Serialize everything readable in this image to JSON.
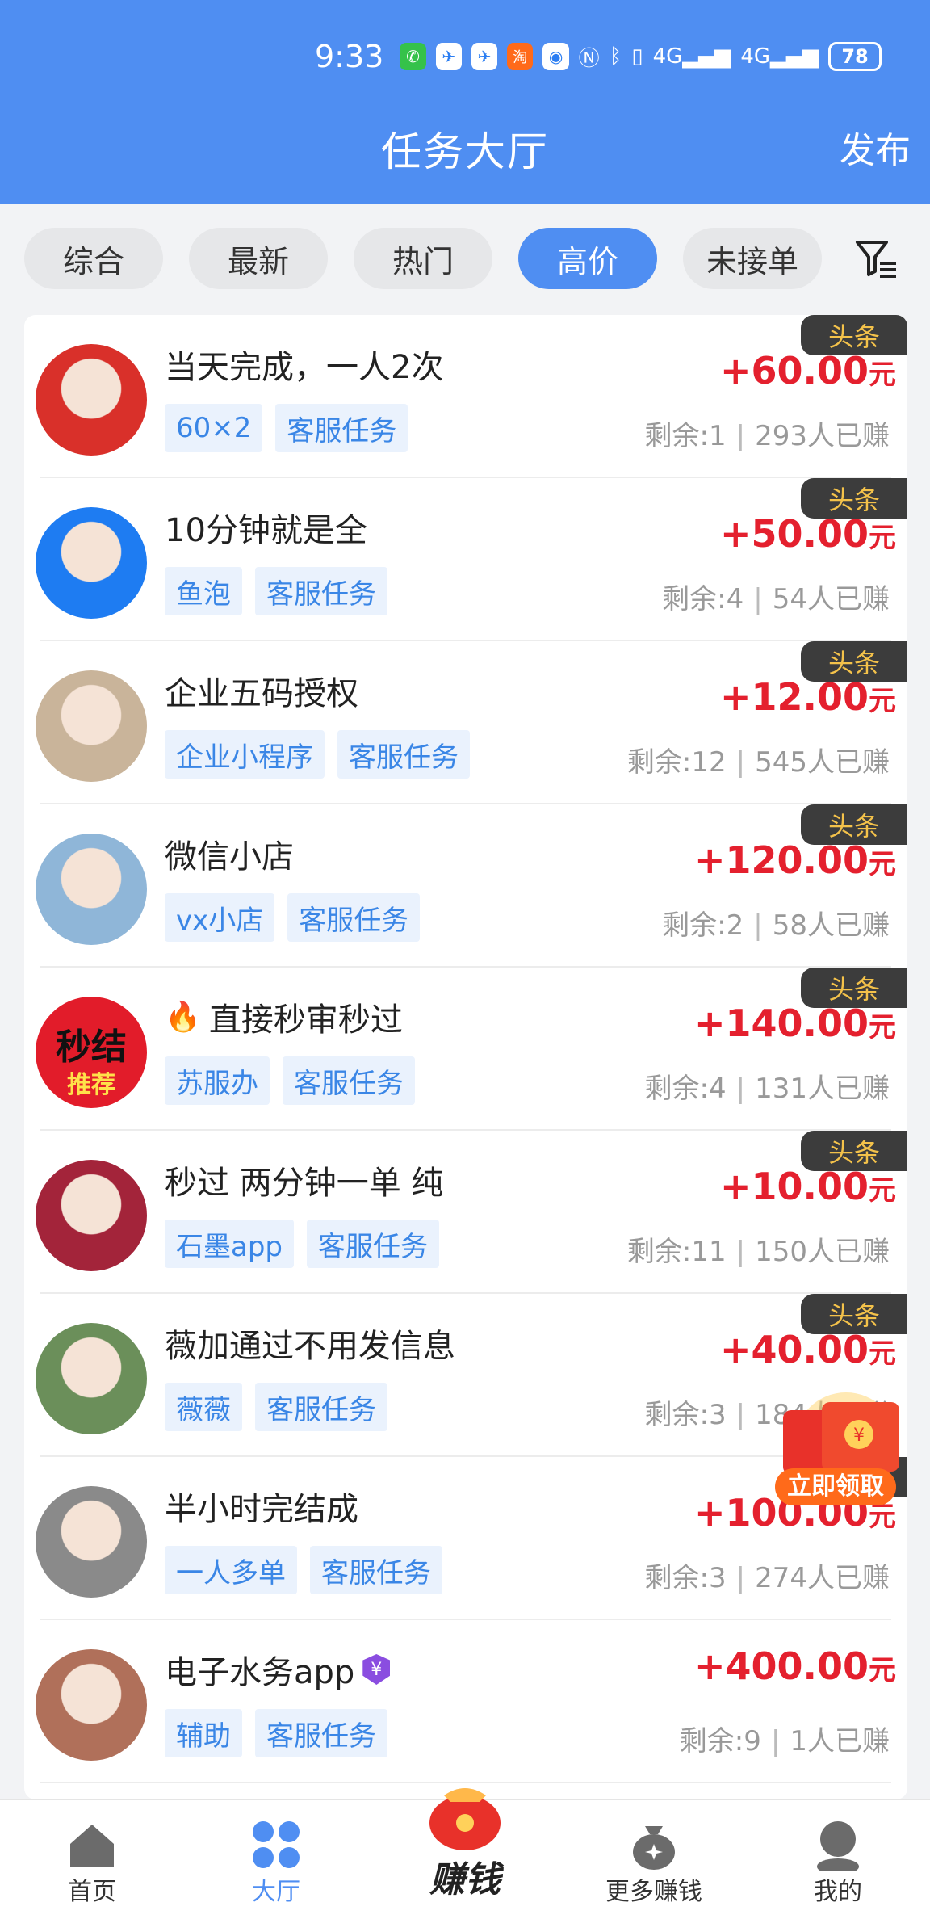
{
  "status_bar": {
    "time": "9:33",
    "network_1": "4G",
    "network_2": "4G",
    "battery": "78"
  },
  "header": {
    "title": "任务大厅",
    "publish_label": "发布"
  },
  "filters": [
    {
      "label": "综合",
      "active": false
    },
    {
      "label": "最新",
      "active": false
    },
    {
      "label": "热门",
      "active": false
    },
    {
      "label": "高价",
      "active": true
    },
    {
      "label": "未接单",
      "active": false
    }
  ],
  "tasks": [
    {
      "title": "当天完成，一人2次",
      "fire": false,
      "verified": false,
      "tags": [
        "60×2",
        "客服任务"
      ],
      "badge": "头条",
      "price": "+60.00",
      "unit": "元",
      "remaining": "剩余:1",
      "earned": "293人已赚",
      "avatar_color": "#d9302a"
    },
    {
      "title": "10分钟就是全",
      "fire": false,
      "verified": false,
      "tags": [
        "鱼泡",
        "客服任务"
      ],
      "badge": "头条",
      "price": "+50.00",
      "unit": "元",
      "remaining": "剩余:4",
      "earned": "54人已赚",
      "avatar_color": "#1e7cf2"
    },
    {
      "title": "企业五码授权",
      "fire": false,
      "verified": false,
      "tags": [
        "企业小程序",
        "客服任务"
      ],
      "badge": "头条",
      "price": "+12.00",
      "unit": "元",
      "remaining": "剩余:12",
      "earned": "545人已赚",
      "avatar_color": "#c9b49a"
    },
    {
      "title": "微信小店",
      "fire": false,
      "verified": false,
      "tags": [
        "vx小店",
        "客服任务"
      ],
      "badge": "头条",
      "price": "+120.00",
      "unit": "元",
      "remaining": "剩余:2",
      "earned": "58人已赚",
      "avatar_color": "#8fb6d8"
    },
    {
      "title": "直接秒审秒过",
      "fire": true,
      "verified": false,
      "tags": [
        "苏服办",
        "客服任务"
      ],
      "badge": "头条",
      "price": "+140.00",
      "unit": "元",
      "remaining": "剩余:4",
      "earned": "131人已赚",
      "avatar_color": "#e21c2a",
      "avatar_text_1": "秒结",
      "avatar_text_2": "推荐"
    },
    {
      "title": "秒过 两分钟一单 纯",
      "fire": false,
      "verified": false,
      "tags": [
        "石墨app",
        "客服任务"
      ],
      "badge": "头条",
      "price": "+10.00",
      "unit": "元",
      "remaining": "剩余:11",
      "earned": "150人已赚",
      "avatar_color": "#a3243a"
    },
    {
      "title": "薇加通过不用发信息",
      "fire": false,
      "verified": false,
      "tags": [
        "薇薇",
        "客服任务"
      ],
      "badge": "头条",
      "price": "+40.00",
      "unit": "元",
      "remaining": "剩余:3",
      "earned": "184人已赚",
      "avatar_color": "#6b8f5a"
    },
    {
      "title": "半小时完结成",
      "fire": false,
      "verified": false,
      "tags": [
        "一人多单",
        "客服任务"
      ],
      "badge": "头条",
      "price": "+100.00",
      "unit": "元",
      "remaining": "剩余:3",
      "earned": "274人已赚",
      "avatar_color": "#8a8a8a"
    },
    {
      "title": "电子水务app",
      "fire": false,
      "verified": true,
      "tags": [
        "辅助",
        "客服任务"
      ],
      "badge": "",
      "price": "+400.00",
      "unit": "元",
      "remaining": "剩余:9",
      "earned": "1人已赚",
      "avatar_color": "#b0705a"
    }
  ],
  "floating_packet": {
    "label": "立即领取"
  },
  "bottom_nav": [
    {
      "label": "首页",
      "icon": "home-icon",
      "active": false
    },
    {
      "label": "大厅",
      "icon": "grid-icon",
      "active": true
    },
    {
      "label": "赚钱",
      "icon": "money-bag-icon",
      "active": false
    },
    {
      "label": "更多赚钱",
      "icon": "coin-bag-icon",
      "active": false
    },
    {
      "label": "我的",
      "icon": "profile-icon",
      "active": false
    }
  ],
  "colors": {
    "primary": "#4f8ef2",
    "price_red": "#e4202e",
    "badge_bg": "#3c3c3c",
    "badge_text": "#f4c24a",
    "tag_bg": "#eaf2fd",
    "tag_text": "#3a86e6"
  }
}
